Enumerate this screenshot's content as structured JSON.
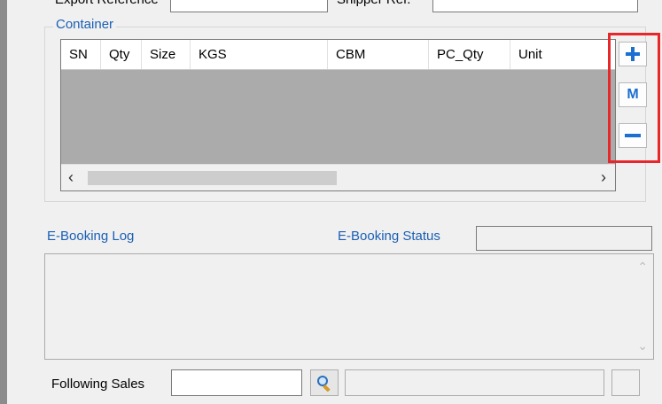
{
  "top_row": {
    "export_reference_label": "Export Reference",
    "shipper_ref_label": "Shipper Ref."
  },
  "container": {
    "title": "Container",
    "columns": [
      "SN",
      "Qty",
      "Size",
      "KGS",
      "CBM",
      "PC_Qty",
      "Unit"
    ],
    "rows": []
  },
  "side_buttons": {
    "add_icon": "plus-icon",
    "modify_label": "M",
    "remove_icon": "minus-icon"
  },
  "ebooking": {
    "log_label": "E-Booking Log",
    "status_label": "E-Booking Status",
    "status_value": "",
    "log_text": ""
  },
  "footer": {
    "following_sales_label": "Following Sales",
    "following_sales_value": "",
    "sales_name_value": ""
  },
  "colors": {
    "accent_blue": "#1a5fb4",
    "highlight_red": "#e8272b",
    "grid_body": "#ababab"
  }
}
